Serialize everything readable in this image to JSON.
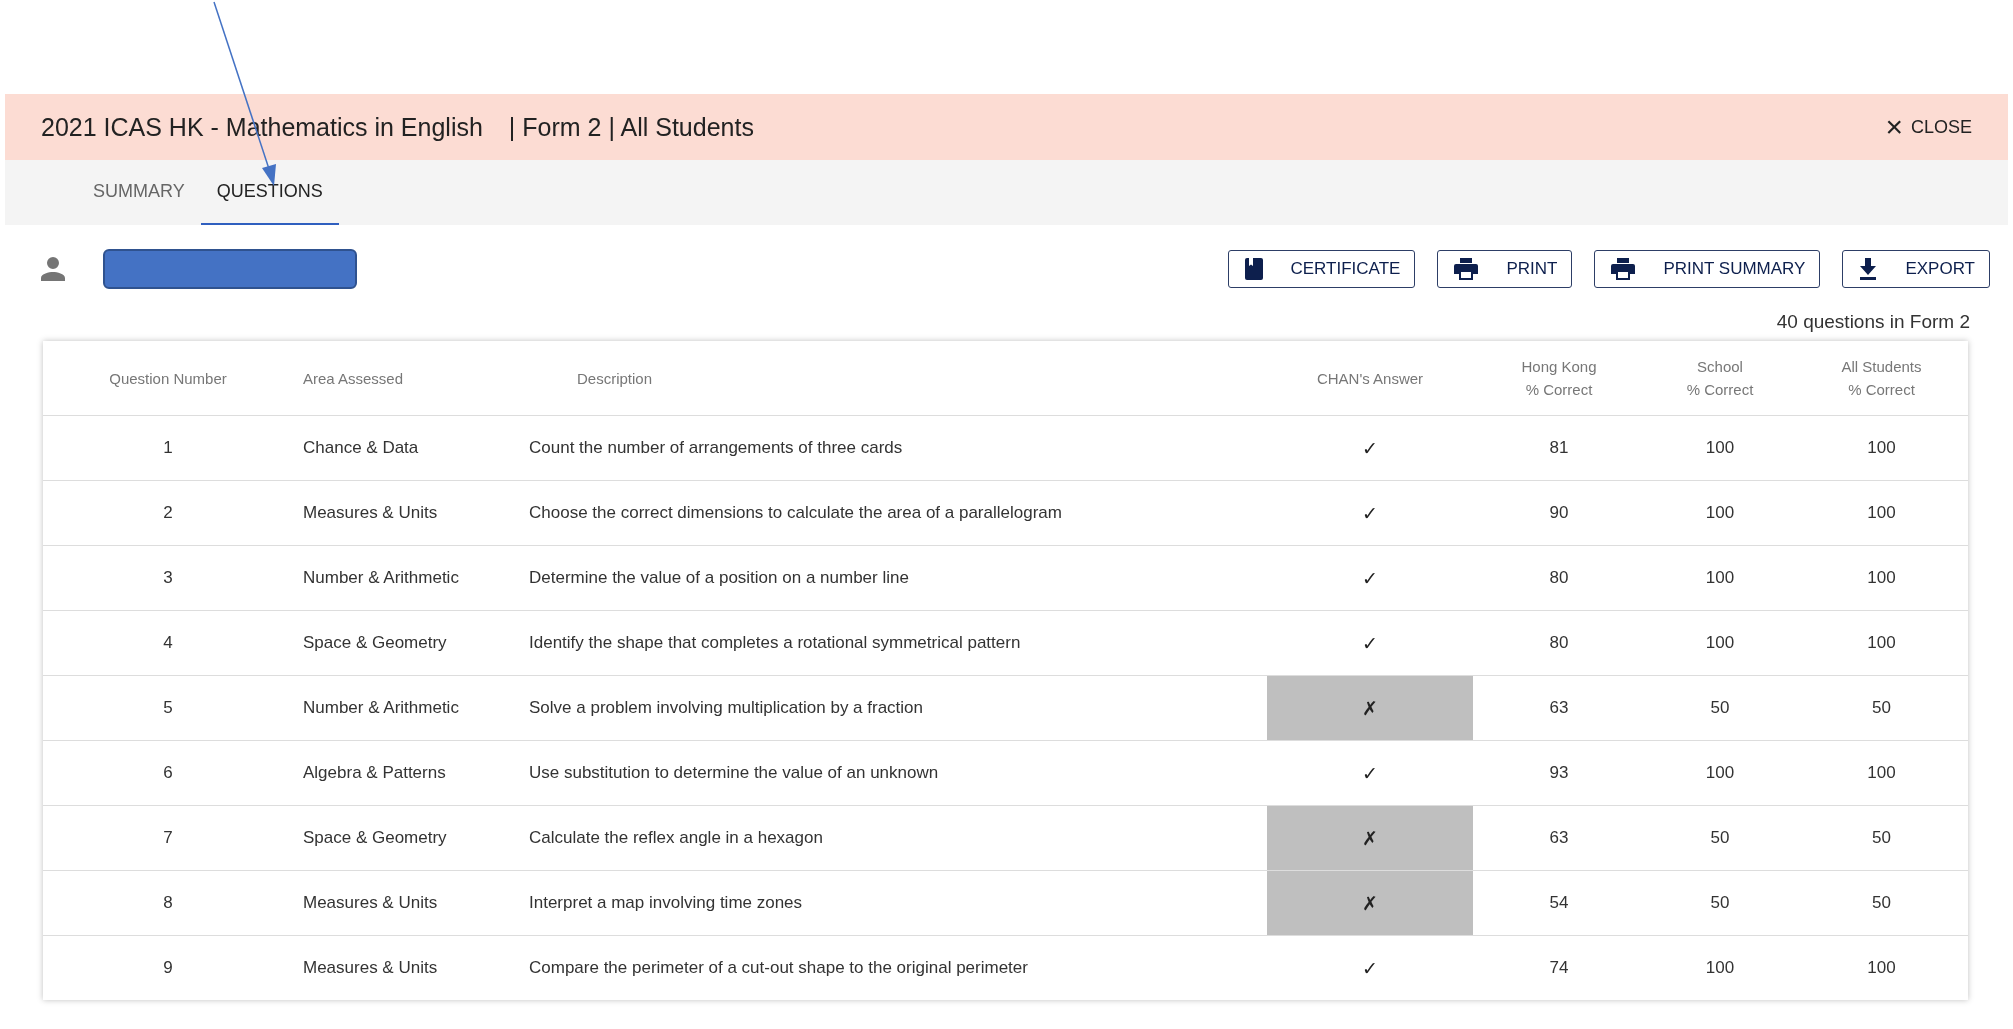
{
  "header": {
    "title": "2021 ICAS HK - Mathematics in English",
    "context": "| Form 2 | All Students",
    "close": {
      "icon": "×",
      "label": "CLOSE"
    }
  },
  "tabs": [
    {
      "label": "SUMMARY",
      "selected": false
    },
    {
      "label": "QUESTIONS",
      "selected": true
    }
  ],
  "actions": [
    {
      "kind": "certificate",
      "label": "CERTIFICATE"
    },
    {
      "kind": "print",
      "label": "PRINT"
    },
    {
      "kind": "print",
      "label": "PRINT SUMMARY"
    },
    {
      "kind": "export",
      "label": "EXPORT"
    }
  ],
  "question_count": "40 questions in Form 2",
  "table": {
    "columns": [
      [
        "Question Number"
      ],
      [
        "Area Assessed"
      ],
      [
        "Description"
      ],
      [
        "CHAN's Answer"
      ],
      [
        "Hong Kong",
        "% Correct"
      ],
      [
        "School",
        "% Correct"
      ],
      [
        "All Students",
        "% Correct"
      ]
    ],
    "rows": [
      {
        "number": "1",
        "area": "Chance & Data",
        "description": "Count the number of arrangements of three cards",
        "answer": "✓",
        "correct": true,
        "hong_kong": "81",
        "school": "100",
        "all_students": "100"
      },
      {
        "number": "2",
        "area": "Measures & Units",
        "description": "Choose the correct dimensions to calculate the area of a parallelogram",
        "answer": "✓",
        "correct": true,
        "hong_kong": "90",
        "school": "100",
        "all_students": "100"
      },
      {
        "number": "3",
        "area": "Number & Arithmetic",
        "description": "Determine the value of a position on a number line",
        "answer": "✓",
        "correct": true,
        "hong_kong": "80",
        "school": "100",
        "all_students": "100"
      },
      {
        "number": "4",
        "area": "Space & Geometry",
        "description": "Identify the shape that completes a rotational symmetrical pattern",
        "answer": "✓",
        "correct": true,
        "hong_kong": "80",
        "school": "100",
        "all_students": "100"
      },
      {
        "number": "5",
        "area": "Number & Arithmetic",
        "description": "Solve a problem involving multiplication by a fraction",
        "answer": "✗",
        "correct": false,
        "hong_kong": "63",
        "school": "50",
        "all_students": "50"
      },
      {
        "number": "6",
        "area": "Algebra & Patterns",
        "description": "Use substitution to determine the value of an unknown",
        "answer": "✓",
        "correct": true,
        "hong_kong": "93",
        "school": "100",
        "all_students": "100"
      },
      {
        "number": "7",
        "area": "Space & Geometry",
        "description": "Calculate the reflex angle in a hexagon",
        "answer": "✗",
        "correct": false,
        "hong_kong": "63",
        "school": "50",
        "all_students": "50"
      },
      {
        "number": "8",
        "area": "Measures & Units",
        "description": "Interpret a map involving time zones",
        "answer": "✗",
        "correct": false,
        "hong_kong": "54",
        "school": "50",
        "all_students": "50"
      },
      {
        "number": "9",
        "area": "Measures & Units",
        "description": "Compare the perimeter of a cut-out shape to the original perimeter",
        "answer": "✓",
        "correct": true,
        "hong_kong": "74",
        "school": "100",
        "all_students": "100"
      }
    ]
  }
}
